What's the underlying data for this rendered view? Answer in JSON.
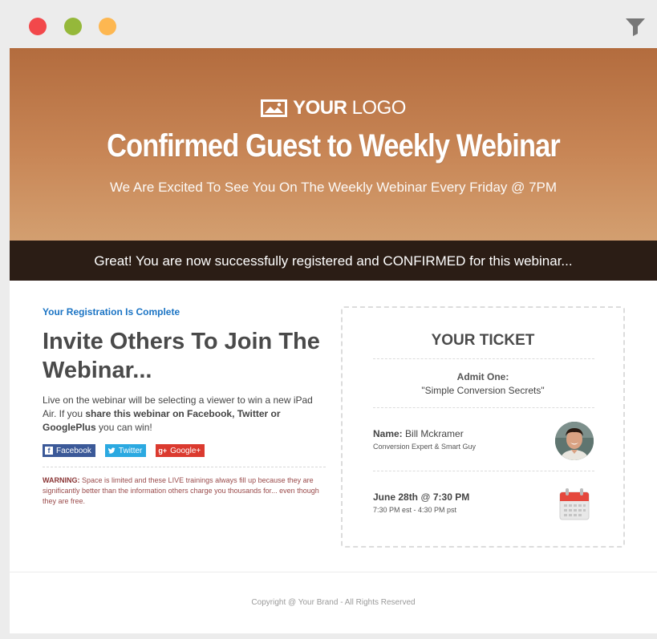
{
  "window": {
    "controls": [
      "close",
      "minimize",
      "maximize"
    ],
    "colors": {
      "close": "#f2484b",
      "minimize": "#95b83a",
      "maximize": "#fdb751"
    },
    "toolbar_icon": "filter-icon"
  },
  "hero": {
    "logo_icon": "image-icon",
    "logo_text_bold": "YOUR",
    "logo_text_light": "LOGO",
    "title": "Confirmed Guest to Weekly Webinar",
    "subtitle": "We Are Excited To See You On The Weekly Webinar Every Friday @ 7PM",
    "gradient_colors": [
      "#b36c3e",
      "#d39f70"
    ]
  },
  "banner": {
    "text": "Great! You are now successfully registered and CONFIRMED for this webinar...",
    "bg_color": "#2b1d15"
  },
  "left": {
    "status": "Your Registration Is Complete",
    "heading": "Invite Others To Join The Webinar...",
    "desc_part1": "Live on the webinar will be selecting a viewer to win a new iPad Air. If you ",
    "desc_bold": "share this webinar on Facebook, Twitter or GooglePlus",
    "desc_part2": " you can win!",
    "social_buttons": [
      {
        "label": "Facebook",
        "icon": "facebook-icon",
        "color": "#3b5998"
      },
      {
        "label": "Twitter",
        "icon": "twitter-icon",
        "color": "#2ba9e1"
      },
      {
        "label": "Google+",
        "icon": "google-plus-icon",
        "color": "#db3a2f"
      }
    ],
    "warning_label": "WARNING:",
    "warning_text": " Space is limited and these LIVE trainings always fill up because they are significantly better than the information others charge you thousands for... even though they are free."
  },
  "ticket": {
    "title": "YOUR TICKET",
    "admit_label": "Admit One:",
    "admit_value": "\"Simple Conversion Secrets\"",
    "name_label": "Name:",
    "name_value": " Bill Mckramer",
    "name_role": "Conversion Expert & Smart Guy",
    "avatar_icon": "avatar",
    "date_bold": "June 28th",
    "date_at": " @ ",
    "time_bold": "7:30 PM",
    "time_detail": "7:30 PM est - 4:30 PM pst",
    "calendar_icon": "calendar-icon"
  },
  "footer": {
    "copyright": "Copyright @ Your Brand - All Rights Reserved"
  }
}
